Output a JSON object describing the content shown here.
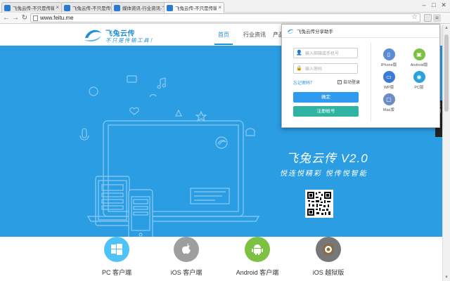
{
  "browser": {
    "tabs": [
      {
        "title": "飞兔云传-不只是传输工具"
      },
      {
        "title": "飞兔云传-不只是传输工具"
      },
      {
        "title": "媒体资讯-行业资讯-飞兔..."
      },
      {
        "title": "飞兔云传-不只是传输工具"
      }
    ],
    "active_tab": 3,
    "url": "www.feitu.me",
    "window_controls": {
      "min": "–",
      "max": "□",
      "close": "✕"
    },
    "nav": {
      "back": "←",
      "forward": "→",
      "reload": "↻",
      "star": "☆"
    }
  },
  "site": {
    "logo_name": "飞兔云传",
    "slogan": "不只是传输工具！",
    "nav": [
      "首页",
      "行业资讯",
      "产品"
    ],
    "active_nav": 0,
    "hero_title": "飞兔云传 V2.0",
    "hero_slogan": "悦连悦精彩  悦传悦智能",
    "side_float": "说明",
    "downloads": [
      {
        "label": "PC 客户端",
        "color": "#4fc3f7",
        "icon": "windows-icon"
      },
      {
        "label": "iOS 客户端",
        "color": "#9e9e9e",
        "icon": "apple-icon"
      },
      {
        "label": "Android 客户端",
        "color": "#7cc142",
        "icon": "android-icon"
      },
      {
        "label": "iOS 越狱版",
        "color": "#777777",
        "icon": "cydia-icon"
      }
    ]
  },
  "popup": {
    "title": "飞兔云传分享助手",
    "account_placeholder": "输入邮箱或手机号",
    "password_placeholder": "输入密码",
    "forgot": "忘记密码？",
    "auto_login": "自动登录",
    "login": "确定",
    "register": "注册帐号",
    "platforms": [
      {
        "label": "iPhone版",
        "color": "#5b8dd6",
        "icon": "iphone-icon"
      },
      {
        "label": "Android版",
        "color": "#7cc142",
        "icon": "android-icon"
      },
      {
        "label": "WP版",
        "color": "#3a7bd5",
        "icon": "windows-phone-icon"
      },
      {
        "label": "PC版",
        "color": "#2aa1e0",
        "icon": "pc-icon"
      },
      {
        "label": "Mac版",
        "color": "#6b8cc7",
        "icon": "mac-icon"
      }
    ]
  },
  "colors": {
    "brand": "#1e8fd8",
    "hero": "#2b9de3",
    "login": "#2e9bf0",
    "register": "#2fb3a3"
  }
}
